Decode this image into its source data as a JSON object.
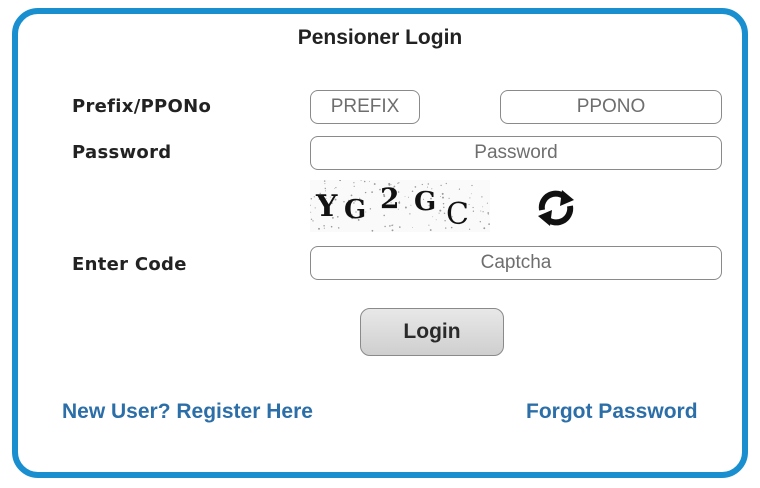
{
  "form": {
    "title": "Pensioner Login",
    "labels": {
      "prefix_ppono": "Prefix/PPONo",
      "password": "Password",
      "enter_code": "Enter Code"
    },
    "inputs": {
      "prefix": {
        "value": "",
        "placeholder": "PREFIX"
      },
      "ppono": {
        "value": "",
        "placeholder": "PPONO"
      },
      "password": {
        "value": "",
        "placeholder": "Password"
      },
      "captcha": {
        "value": "",
        "placeholder": "Captcha"
      }
    },
    "captcha_text": [
      "Y",
      "G",
      "2",
      "G",
      "C"
    ],
    "login_button": "Login",
    "links": {
      "register": "New User? Register Here",
      "forgot": "Forgot Password"
    }
  },
  "colors": {
    "border_accent": "#1a8fd0",
    "link": "#2c6fa8",
    "button_bg": "#dcdcdc"
  },
  "icons": {
    "refresh": "refresh-icon"
  }
}
